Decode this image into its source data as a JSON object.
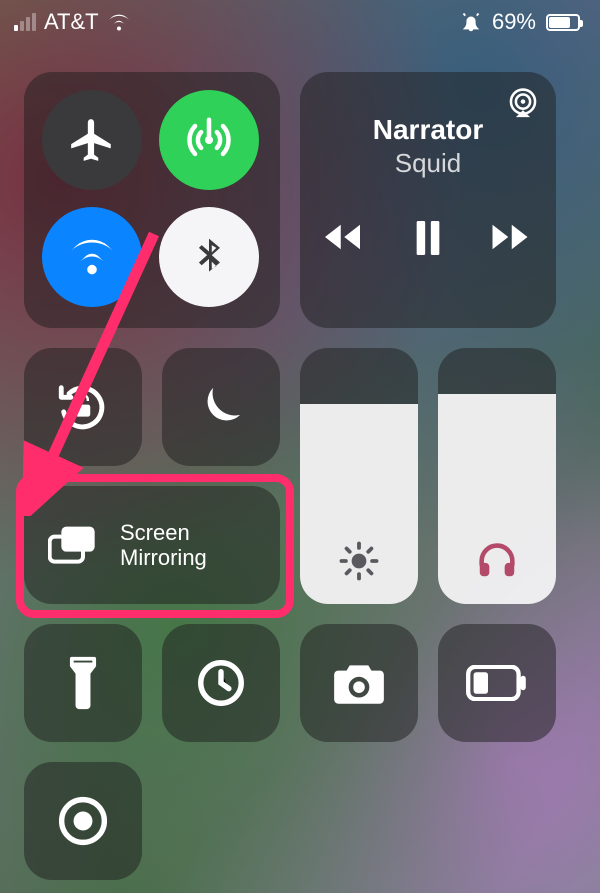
{
  "status": {
    "carrier": "AT&T",
    "battery_text": "69%",
    "battery_pct": 69,
    "signal_bars_on": 1,
    "alarm": true
  },
  "media": {
    "title": "Narrator",
    "subtitle": "Squid"
  },
  "mirror": {
    "line1": "Screen",
    "line2": "Mirroring"
  },
  "sliders": {
    "brightness_pct": 78,
    "volume_pct": 82
  },
  "colors": {
    "highlight": "#ff2d6b",
    "green": "#30d158",
    "blue": "#0a84ff"
  }
}
